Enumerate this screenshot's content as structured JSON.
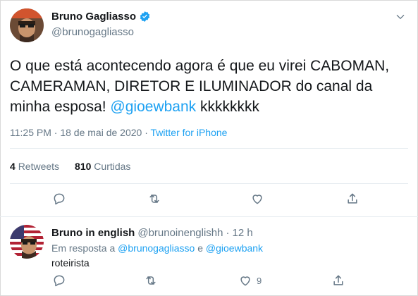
{
  "tweet": {
    "author": {
      "display_name": "Bruno Gagliasso",
      "handle": "@brunogagliasso",
      "verified": true,
      "avatar_icon": "profile-photo"
    },
    "text_before": "O que está acontecendo agora é que eu virei CABOMAN, CAMERAMAN, DIRETOR E ILUMINADOR do canal da minha esposa! ",
    "mention": "@gioewbank",
    "text_after": " kkkkkkkk",
    "timestamp": "11:25 PM · 18 de mai de 2020 · ",
    "source": "Twitter for iPhone",
    "stats": {
      "retweets_count": "4",
      "retweets_label": "Retweets",
      "likes_count": "810",
      "likes_label": "Curtidas"
    },
    "actions": [
      "reply-icon",
      "retweet-icon",
      "like-icon",
      "share-icon"
    ]
  },
  "reply": {
    "author": {
      "display_name": "Bruno in english",
      "handle": "@brunoinenglishh",
      "time": "12 h",
      "avatar_icon": "profile-photo-us-flag"
    },
    "replying_prefix": "Em resposta a",
    "replying_mention_1": "@brunogagliasso",
    "replying_joiner": "e",
    "replying_mention_2": "@gioewbank",
    "text": "roteirista",
    "like_count": "9",
    "actions": [
      "reply-icon",
      "retweet-icon",
      "like-icon",
      "share-icon"
    ]
  },
  "colors": {
    "accent": "#1da1f2",
    "muted": "#657786",
    "text": "#14171a",
    "divider": "#e6ecf0"
  }
}
